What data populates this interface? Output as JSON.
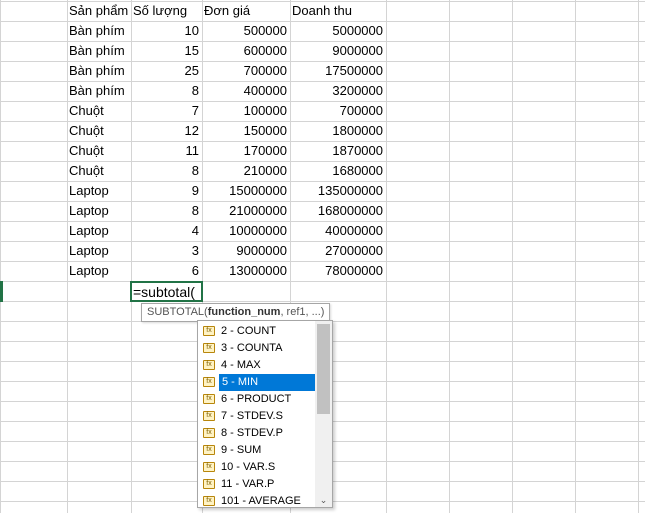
{
  "headers": [
    "Sản phẩm",
    "Số lượng",
    "Đơn giá",
    "Doanh thu"
  ],
  "rows": [
    [
      "Bàn phím",
      "10",
      "500000",
      "5000000"
    ],
    [
      "Bàn phím",
      "15",
      "600000",
      "9000000"
    ],
    [
      "Bàn phím",
      "25",
      "700000",
      "17500000"
    ],
    [
      "Bàn phím",
      "8",
      "400000",
      "3200000"
    ],
    [
      "Chuột",
      "7",
      "100000",
      "700000"
    ],
    [
      "Chuột",
      "12",
      "150000",
      "1800000"
    ],
    [
      "Chuột",
      "11",
      "170000",
      "1870000"
    ],
    [
      "Chuột",
      "8",
      "210000",
      "1680000"
    ],
    [
      "Laptop",
      "9",
      "15000000",
      "135000000"
    ],
    [
      "Laptop",
      "8",
      "21000000",
      "168000000"
    ],
    [
      "Laptop",
      "4",
      "10000000",
      "40000000"
    ],
    [
      "Laptop",
      "3",
      "9000000",
      "27000000"
    ],
    [
      "Laptop",
      "6",
      "13000000",
      "78000000"
    ]
  ],
  "formula": "=subtotal(",
  "tooltip": {
    "func": "SUBTOTAL(",
    "arg_bold": "function_num",
    "rest": ", ref1, ...)"
  },
  "dropdown": {
    "items": [
      "2 - COUNT",
      "3 - COUNTA",
      "4 - MAX",
      "5 - MIN",
      "6 - PRODUCT",
      "7 - STDEV.S",
      "8 - STDEV.P",
      "9 - SUM",
      "10 - VAR.S",
      "11 - VAR.P",
      "101 - AVERAGE"
    ],
    "selected_index": 3,
    "icon": "function-icon",
    "icon_glyph": "fx",
    "scroll_down_glyph": "⌄"
  },
  "colors": {
    "selection": "#217346",
    "highlight": "#0078d7",
    "grid": "#d4d4d4"
  }
}
